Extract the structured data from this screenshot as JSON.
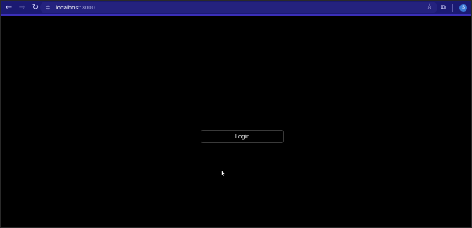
{
  "browser": {
    "url_host": "localhost",
    "url_port": ":3000",
    "profile_initial": "S",
    "accent_color": "#1b1a72",
    "icons": {
      "back": "back-arrow-icon",
      "forward": "forward-arrow-icon",
      "reload": "reload-icon",
      "site_info": "site-info-icon",
      "bookmark": "star-icon",
      "extensions": "puzzle-icon"
    }
  },
  "page": {
    "background": "#000000",
    "login_label": "Login"
  }
}
